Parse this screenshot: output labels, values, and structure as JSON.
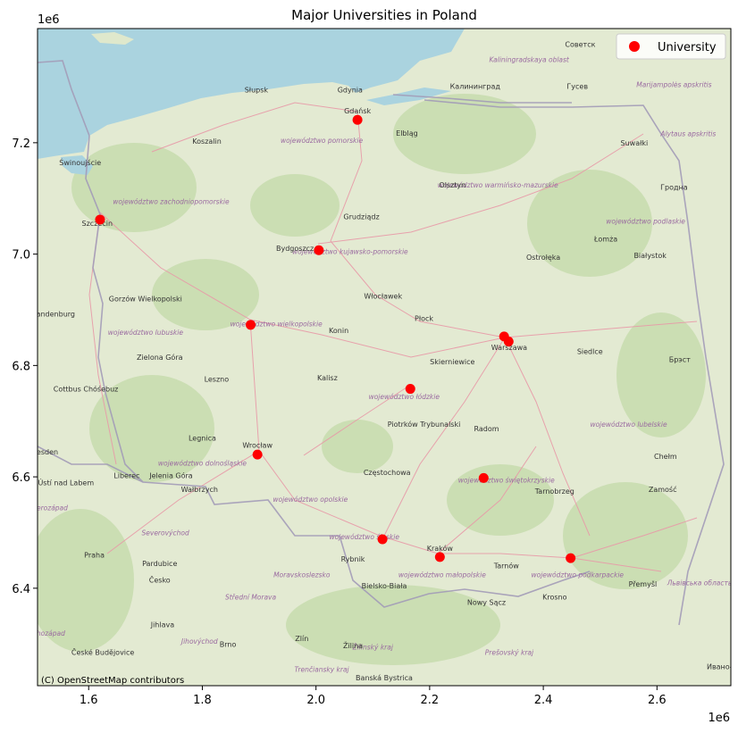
{
  "chart_data": {
    "type": "scatter",
    "title": "Major Universities in Poland",
    "xlabel": "",
    "ylabel": "",
    "xlim": [
      1510000,
      2730000
    ],
    "ylim": [
      6225000,
      7405000
    ],
    "x_ticks": [
      1600000,
      1800000,
      2000000,
      2200000,
      2400000,
      2600000
    ],
    "y_ticks": [
      6400000,
      6600000,
      6800000,
      7000000,
      7200000
    ],
    "x_tick_labels": [
      "1.6",
      "1.8",
      "2.0",
      "2.2",
      "2.4",
      "2.6"
    ],
    "y_tick_labels": [
      "6.4",
      "6.6",
      "6.8",
      "7.0",
      "7.2"
    ],
    "x_offset_label": "1e6",
    "y_offset_label": "1e6",
    "marker_color": "#ff0000",
    "legend": {
      "position": "upper-right",
      "entries": [
        "University"
      ]
    },
    "attribution": "(C) OpenStreetMap contributors",
    "series": [
      {
        "name": "University",
        "x": [
          1620000,
          2073000,
          2005000,
          1885000,
          1897000,
          2166000,
          2331000,
          2339000,
          2295000,
          2117000,
          2218000,
          2448000
        ],
        "y": [
          7062000,
          7241000,
          7007000,
          6873000,
          6640000,
          6758000,
          6852000,
          6843000,
          6598000,
          6488000,
          6456000,
          6454000
        ]
      }
    ]
  },
  "basemap": {
    "cities": [
      {
        "name": "Gdańsk",
        "x": 2073000,
        "y": 7253000
      },
      {
        "name": "Gdynia",
        "x": 2060000,
        "y": 7290000
      },
      {
        "name": "Słupsk",
        "x": 1895000,
        "y": 7290000
      },
      {
        "name": "Koszalin",
        "x": 1808000,
        "y": 7198000
      },
      {
        "name": "Elbląg",
        "x": 2160000,
        "y": 7213000
      },
      {
        "name": "Калининград",
        "x": 2280000,
        "y": 7297000
      },
      {
        "name": "Гусев",
        "x": 2460000,
        "y": 7297000
      },
      {
        "name": "Советск",
        "x": 2465000,
        "y": 7372000
      },
      {
        "name": "Świnoujście",
        "x": 1585000,
        "y": 7160000
      },
      {
        "name": "Szczecin",
        "x": 1615000,
        "y": 7051000
      },
      {
        "name": "Olsztyn",
        "x": 2240000,
        "y": 7120000
      },
      {
        "name": "Suwałki",
        "x": 2560000,
        "y": 7195000
      },
      {
        "name": "Гродна",
        "x": 2630000,
        "y": 7116000
      },
      {
        "name": "Grudziądz",
        "x": 2080000,
        "y": 7063000
      },
      {
        "name": "Bydgoszcz",
        "x": 1963000,
        "y": 7006000
      },
      {
        "name": "Łomża",
        "x": 2510000,
        "y": 7023000
      },
      {
        "name": "Ostrołęka",
        "x": 2400000,
        "y": 6990000
      },
      {
        "name": "Białystok",
        "x": 2588000,
        "y": 6993000
      },
      {
        "name": "Gorzów Wielkopolski",
        "x": 1700000,
        "y": 6915000
      },
      {
        "name": "Włocławek",
        "x": 2118000,
        "y": 6920000
      },
      {
        "name": "Płock",
        "x": 2190000,
        "y": 6880000
      },
      {
        "name": "Konin",
        "x": 2040000,
        "y": 6858000
      },
      {
        "name": "Warszawa",
        "x": 2340000,
        "y": 6828000
      },
      {
        "name": "Siedlce",
        "x": 2482000,
        "y": 6821000
      },
      {
        "name": "Брэст",
        "x": 2640000,
        "y": 6806000
      },
      {
        "name": "Brandenburg",
        "x": 1535000,
        "y": 6888000
      },
      {
        "name": "Zielona Góra",
        "x": 1725000,
        "y": 6810000
      },
      {
        "name": "Skierniewice",
        "x": 2240000,
        "y": 6802000
      },
      {
        "name": "Leszno",
        "x": 1825000,
        "y": 6771000
      },
      {
        "name": "Kalisz",
        "x": 2020000,
        "y": 6773000
      },
      {
        "name": "Cottbus Chóśebuz",
        "x": 1595000,
        "y": 6753000
      },
      {
        "name": "Piotrków Trybunalski",
        "x": 2190000,
        "y": 6690000
      },
      {
        "name": "Radom",
        "x": 2300000,
        "y": 6682000
      },
      {
        "name": "Legnica",
        "x": 1800000,
        "y": 6665000
      },
      {
        "name": "Wrocław",
        "x": 1897000,
        "y": 6652000
      },
      {
        "name": "Chełm",
        "x": 2615000,
        "y": 6632000
      },
      {
        "name": "Dresden",
        "x": 1520000,
        "y": 6640000
      },
      {
        "name": "Liberec",
        "x": 1667000,
        "y": 6598000
      },
      {
        "name": "Jelenia Góra",
        "x": 1745000,
        "y": 6598000
      },
      {
        "name": "Wałbrzych",
        "x": 1795000,
        "y": 6573000
      },
      {
        "name": "Ústí nad Labem",
        "x": 1560000,
        "y": 6585000
      },
      {
        "name": "Częstochowa",
        "x": 2125000,
        "y": 6603000
      },
      {
        "name": "Tarnobrzeg",
        "x": 2420000,
        "y": 6570000
      },
      {
        "name": "Zamość",
        "x": 2610000,
        "y": 6573000
      },
      {
        "name": "Praha",
        "x": 1610000,
        "y": 6455000
      },
      {
        "name": "Pardubice",
        "x": 1725000,
        "y": 6440000
      },
      {
        "name": "Rybnik",
        "x": 2065000,
        "y": 6448000
      },
      {
        "name": "Kraków",
        "x": 2218000,
        "y": 6467000
      },
      {
        "name": "Tarnów",
        "x": 2335000,
        "y": 6436000
      },
      {
        "name": "Přemyšl",
        "x": 2575000,
        "y": 6403000
      },
      {
        "name": "Česko",
        "x": 1725000,
        "y": 6410000
      },
      {
        "name": "Bielsko-Biała",
        "x": 2120000,
        "y": 6400000
      },
      {
        "name": "Krosno",
        "x": 2420000,
        "y": 6380000
      },
      {
        "name": "Nowy Sącz",
        "x": 2300000,
        "y": 6370000
      },
      {
        "name": "Jihlava",
        "x": 1730000,
        "y": 6330000
      },
      {
        "name": "Brno",
        "x": 1845000,
        "y": 6295000
      },
      {
        "name": "Zlín",
        "x": 1975000,
        "y": 6305000
      },
      {
        "name": "Žilina",
        "x": 2065000,
        "y": 6292000
      },
      {
        "name": "Banská Bystrica",
        "x": 2120000,
        "y": 6235000
      },
      {
        "name": "České Budějovice",
        "x": 1625000,
        "y": 6280000
      },
      {
        "name": "Ивано-",
        "x": 2710000,
        "y": 6255000
      }
    ],
    "regions": [
      {
        "name": "województwo pomorskie",
        "x": 2010000,
        "y": 7200000
      },
      {
        "name": "województwo zachodniopomorskie",
        "x": 1745000,
        "y": 7090000
      },
      {
        "name": "województwo warmińsko-mazurskie",
        "x": 2320000,
        "y": 7120000
      },
      {
        "name": "województwo podlaskie",
        "x": 2580000,
        "y": 7055000
      },
      {
        "name": "województwo kujawsko-pomorskie",
        "x": 2060000,
        "y": 7000000
      },
      {
        "name": "województwo wielkopolskie",
        "x": 1930000,
        "y": 6870000
      },
      {
        "name": "województwo lubuskie",
        "x": 1700000,
        "y": 6855000
      },
      {
        "name": "województwo łódzkie",
        "x": 2155000,
        "y": 6740000
      },
      {
        "name": "województwo lubelskie",
        "x": 2550000,
        "y": 6690000
      },
      {
        "name": "województwo dolnośląskie",
        "x": 1800000,
        "y": 6620000
      },
      {
        "name": "województwo świętokrzyskie",
        "x": 2335000,
        "y": 6590000
      },
      {
        "name": "województwo opolskie",
        "x": 1990000,
        "y": 6555000
      },
      {
        "name": "województwo śląskie",
        "x": 2085000,
        "y": 6488000
      },
      {
        "name": "województwo małopolskie",
        "x": 2222000,
        "y": 6420000
      },
      {
        "name": "województwo podkarpackie",
        "x": 2460000,
        "y": 6420000
      },
      {
        "name": "Kaliningradskaya oblast",
        "x": 2375000,
        "y": 7345000
      },
      {
        "name": "Marijampolės apskritis",
        "x": 2630000,
        "y": 7300000
      },
      {
        "name": "Alytaus apskritis",
        "x": 2655000,
        "y": 7212000
      },
      {
        "name": "Львівська область",
        "x": 2675000,
        "y": 6405000
      },
      {
        "name": "Severovýchod",
        "x": 1735000,
        "y": 6495000
      },
      {
        "name": "Moravskoslezsko",
        "x": 1975000,
        "y": 6420000
      },
      {
        "name": "Střední Morava",
        "x": 1885000,
        "y": 6380000
      },
      {
        "name": "Jihovýchod",
        "x": 1795000,
        "y": 6300000
      },
      {
        "name": "Jihozápad",
        "x": 1530000,
        "y": 6315000
      },
      {
        "name": "Žilinský kraj",
        "x": 2100000,
        "y": 6290000
      },
      {
        "name": "Trenčiansky kraj",
        "x": 2010000,
        "y": 6250000
      },
      {
        "name": "Prešovský kraj",
        "x": 2340000,
        "y": 6280000
      },
      {
        "name": "Severozápad",
        "x": 1525000,
        "y": 6540000
      }
    ]
  }
}
